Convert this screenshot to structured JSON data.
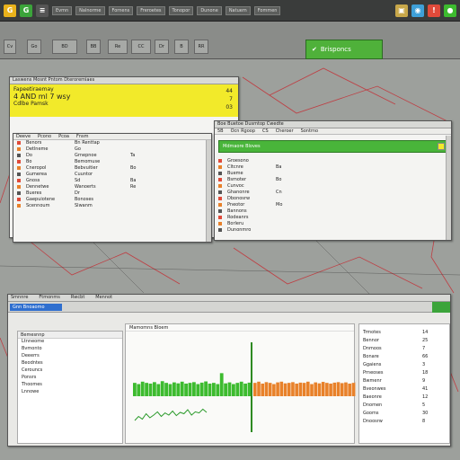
{
  "taskbar": {
    "items": [
      "Evmn",
      "Nalnorme",
      "Fornens",
      "Freroetes",
      "Tonopor",
      "Dunone",
      "Natuem",
      "Fommen"
    ]
  },
  "toolbar": {
    "buttons": [
      "Cv",
      "Go",
      "BD",
      "BB",
      "Re",
      "CC",
      "Dr",
      "B",
      "RR"
    ],
    "green_button_label": "Brisponcs"
  },
  "window_left": {
    "title": "Laswens  Mosnt Pntom  Dteroremiaes",
    "yellow_line1": "Fapeetiraemay",
    "yellow_line2": "4 AND ml 7 wsy",
    "yellow_line3": "Cdlbe Pamsk",
    "yellow_right1": "44",
    "yellow_right2": "7",
    "yellow_right3": "03",
    "menu": [
      "Deeve",
      "Pcono",
      "Pcoa",
      "Fnsm"
    ],
    "rows": [
      {
        "a": "Benors",
        "b": "Bn Renttap",
        "c": ""
      },
      {
        "a": "Detlneme",
        "b": "Go",
        "c": ""
      },
      {
        "a": "Do",
        "b": "Grnepnoe",
        "c": "Ta"
      },
      {
        "a": "Bo",
        "b": "Bemomuse",
        "c": ""
      },
      {
        "a": "Cneropol",
        "b": "Bebvuitier",
        "c": "Bo"
      },
      {
        "a": "Gumerea",
        "b": "Cuuntor",
        "c": ""
      },
      {
        "a": "Gnoss",
        "b": "Sd",
        "c": "Ba"
      },
      {
        "a": "Dennetwe",
        "b": "Wanoerts",
        "c": "Re"
      },
      {
        "a": "Bueres",
        "b": "Dr",
        "c": ""
      },
      {
        "a": "Gaepuiotene",
        "b": "Bonoses",
        "c": ""
      },
      {
        "a": "Scennoum",
        "b": "Slwanm",
        "c": ""
      }
    ]
  },
  "window_right": {
    "title": "Boe  Buetoe  Dusmtop  Cwedte",
    "menu": [
      "5B",
      "Ocn Rgoop",
      "CS",
      "Cheroer",
      "Sontrno"
    ],
    "green_bar_label": "Mdmaore Bloves",
    "rows": [
      {
        "a": "Groesono",
        "b": ""
      },
      {
        "a": "Cltcnre",
        "b": "Ba"
      },
      {
        "a": "Bueme",
        "b": ""
      },
      {
        "a": "Bsmoter",
        "b": "Bo"
      },
      {
        "a": "Cunvoc",
        "b": ""
      },
      {
        "a": "Ghanonre",
        "b": "Cn"
      },
      {
        "a": "Dbonosrw",
        "b": ""
      },
      {
        "a": "Pneotor",
        "b": "Mo"
      },
      {
        "a": "Bannons",
        "b": ""
      },
      {
        "a": "Rodeanrs",
        "b": ""
      },
      {
        "a": "Borleru",
        "b": ""
      },
      {
        "a": "Dunonmro",
        "b": ""
      }
    ]
  },
  "window_bottom": {
    "title_tabs": [
      "Smnnre",
      "Ftmonms",
      "Rwcbt",
      "Mennot"
    ],
    "blue_tab": "Gnn Bnoaomo",
    "sidebar_header": "Bemesnnp",
    "sidebar_items": [
      "Ltnneome",
      "Bvmonto",
      "Deeerrs",
      "Beodntes",
      "Cerouncs",
      "Ponsrs",
      "Thoomes",
      "Lnnowe"
    ],
    "right_items": [
      "Trmotes",
      "Bennor",
      "Dnmoos",
      "Bonare",
      "Ggaiens",
      "Prneoses",
      "Bwmenr",
      "Bveonwes",
      "Baeonre",
      "Dnomen",
      "Gooms",
      "Dnoosrw"
    ],
    "right_values": [
      "14",
      "25",
      "7",
      "66",
      "3",
      "18",
      "9",
      "41",
      "12",
      "5",
      "30",
      "8"
    ],
    "chart_header": "Mamomns  Bloem",
    "colors": {
      "green": "#3dbb2f",
      "orange": "#e8812a",
      "line": "#2a9a2a"
    },
    "bar_levels": {
      "green": [
        0.55,
        0.5,
        0.6,
        0.55,
        0.52,
        0.58,
        0.5,
        0.62,
        0.55,
        0.5,
        0.57,
        0.53,
        0.6,
        0.52,
        0.55,
        0.58,
        0.5,
        0.56,
        0.61,
        0.52,
        0.55,
        0.5,
        0.95,
        0.53,
        0.57,
        0.5,
        0.55,
        0.6,
        0.52,
        0.56
      ],
      "orange": [
        0.55,
        0.6,
        0.52,
        0.58,
        0.55,
        0.5,
        0.57,
        0.6,
        0.53,
        0.55,
        0.58,
        0.52,
        0.56,
        0.55,
        0.6,
        0.5,
        0.57,
        0.53,
        0.59,
        0.55,
        0.52,
        0.56,
        0.58,
        0.54,
        0.57,
        0.52,
        0.55,
        0.6
      ]
    },
    "line_values": [
      0.3,
      0.45,
      0.35,
      0.55,
      0.4,
      0.5,
      0.62,
      0.45,
      0.58,
      0.5,
      0.65,
      0.48,
      0.6,
      0.55,
      0.7,
      0.5,
      0.62,
      0.58,
      0.72,
      0.6
    ]
  }
}
